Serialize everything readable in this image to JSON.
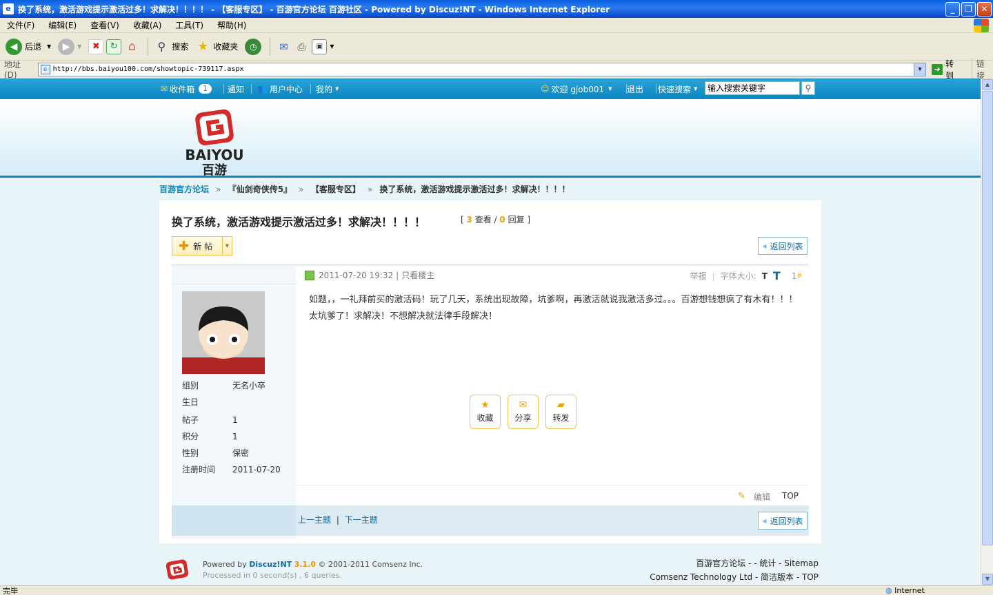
{
  "window": {
    "title": "换了系统，激活游戏提示激活过多！求解决！！！！ - 【客服专区】 - 百游官方论坛 百游社区 - Powered by Discuz!NT - Windows Internet Explorer",
    "minimize": "_",
    "maximize": "❐",
    "close": "✕"
  },
  "menubar": [
    "文件(F)",
    "编辑(E)",
    "查看(V)",
    "收藏(A)",
    "工具(T)",
    "帮助(H)"
  ],
  "toolbar": {
    "back": "后退",
    "search": "搜索",
    "favorites": "收藏夹"
  },
  "address": {
    "label": "地址(D)",
    "url": "http://bbs.baiyou100.com/showtopic-739117.aspx",
    "go": "转到",
    "links": "链接"
  },
  "topnav": {
    "inbox": "收件箱",
    "inbox_count": "1",
    "notice": "通知",
    "user_center": "用户中心",
    "mine": "我的",
    "welcome": "欢迎 gjob001",
    "logout": "退出",
    "quick_search": "快速搜索",
    "search_placeholder": "输入搜索关键字"
  },
  "logo": {
    "text_top": "BAIYOU",
    "text_bottom": "百游"
  },
  "breadcrumb": {
    "home": "百游官方论坛",
    "sep": "»",
    "forum": "『仙剑奇侠传5』",
    "subforum": "【客服专区】",
    "topic": "换了系统，激活游戏提示激活过多！求解决！！！！"
  },
  "thread": {
    "title": "换了系统，激活游戏提示激活过多！求解决！！！！",
    "views": "3",
    "views_label": "查看",
    "replies": "0",
    "replies_label": "回复",
    "new_post": "新帖",
    "back_to_list": "返回列表"
  },
  "user": {
    "fields": [
      {
        "label": "组别",
        "value": "无名小卒"
      },
      {
        "label": "生日",
        "value": ""
      },
      {
        "label": "帖子",
        "value": "1"
      },
      {
        "label": "积分",
        "value": "1"
      },
      {
        "label": "性别",
        "value": "保密"
      },
      {
        "label": "注册时间",
        "value": "2011-07-20"
      }
    ]
  },
  "post": {
    "datetime": "2011-07-20 19:32",
    "only_author": "只看楼主",
    "report": "举报",
    "font_size": "字体大小:",
    "font_small": "T",
    "font_large": "T",
    "floor": "1",
    "floor_mark": "#",
    "body": "如题，，一礼拜前买的激活码！玩了几天，系统出现故障，坑爹啊，再激活就说我激活多过。。。百游想钱想疯了有木有！！！太坑爹了！求解决！不想解决就法律手段解决！",
    "actions": [
      "收藏",
      "分享",
      "转发"
    ],
    "edit": "编辑",
    "top": "TOP"
  },
  "thread_nav": {
    "prev": "上一主题",
    "sep": "|",
    "next": "下一主题"
  },
  "footer": {
    "powered_by": "Powered by",
    "discuz": "Discuz!NT",
    "version": "3.1.0",
    "copyright": "© 2001-2011 Comsenz Inc.",
    "processed": "Processed in 0 second(s) , 6 queries.",
    "links": "百游官方论坛 - - 统计 -  Sitemap",
    "company": "Comsenz Technology Ltd - 简洁版本 - TOP"
  },
  "status": {
    "left": "完毕",
    "zone": "Internet"
  },
  "colors": {
    "accent": "#0b86c1",
    "highlight": "#f3a000",
    "link": "#0b6aa8"
  }
}
